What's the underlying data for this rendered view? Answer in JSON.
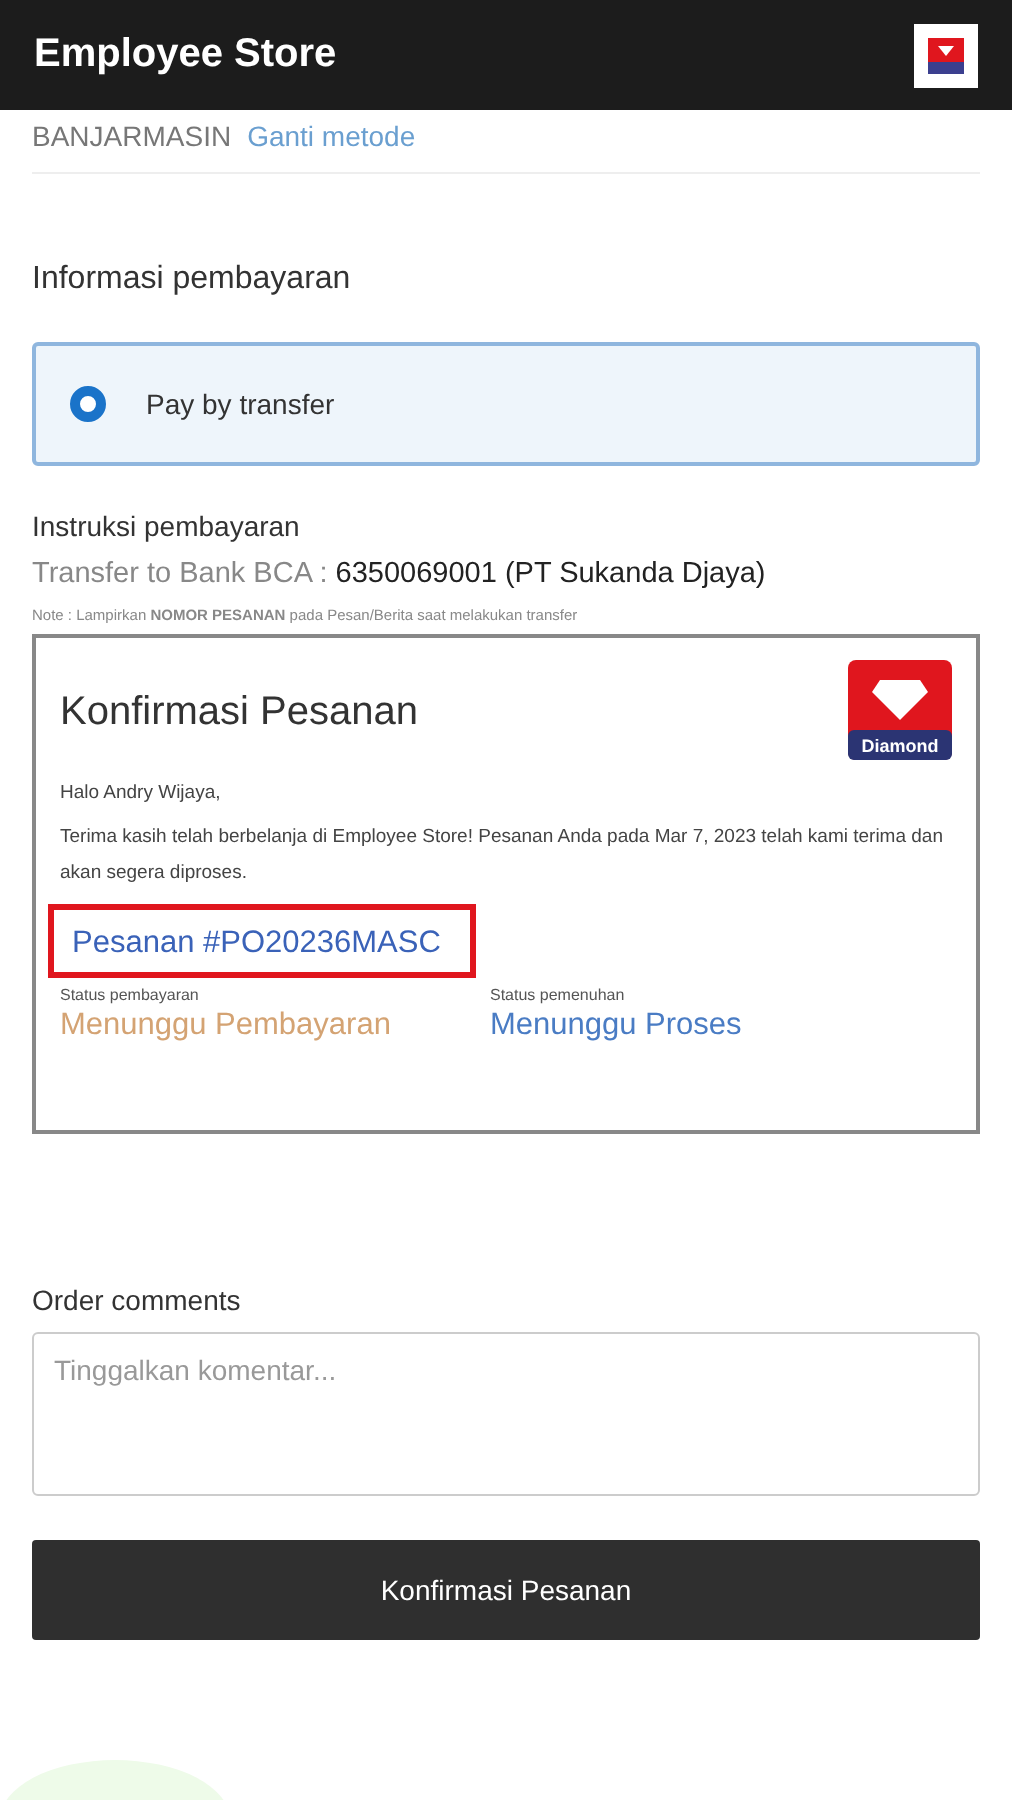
{
  "header": {
    "title": "Employee Store"
  },
  "shipping": {
    "city": "BANJARMASIN",
    "change_link": "Ganti metode"
  },
  "payment": {
    "title": "Informasi pembayaran",
    "options": [
      {
        "label": "Pay by transfer",
        "selected": true
      }
    ]
  },
  "instructions": {
    "title": "Instruksi pembayaran",
    "transfer_label": "Transfer to Bank BCA : ",
    "transfer_account": "6350069001 (PT Sukanda Djaya)",
    "note": "Note : Lampirkan **NOMOR PESANAN** pada Pesan/Berita saat melakukan transfer"
  },
  "confirmation": {
    "title": "Konfirmasi Pesanan",
    "logo_text": "Diamond",
    "greeting": "Halo Andry Wijaya,",
    "message": "Terima kasih telah berbelanja di Employee Store! Pesanan Anda pada Mar 7, 2023 telah kami terima dan akan segera diproses.",
    "order_number": "Pesanan #PO20236MASC",
    "statuses": [
      {
        "label": "Status pembayaran",
        "value": "Menunggu Pembayaran",
        "color": "#d4a373"
      },
      {
        "label": "Status pemenuhan",
        "value": "Menunggu Proses",
        "color": "#4a7cc4"
      }
    ]
  },
  "comments": {
    "label": "Order comments",
    "placeholder": "Tinggalkan komentar..."
  },
  "submit_button": "Konfirmasi Pesanan"
}
